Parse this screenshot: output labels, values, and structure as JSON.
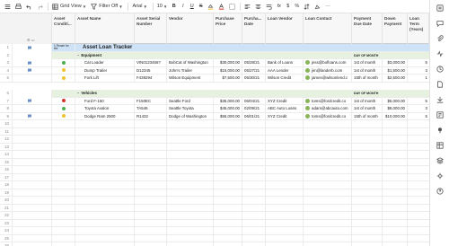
{
  "toolbar": {
    "view_label": "Grid View",
    "filter_label": "Filter Off",
    "font_label": "Arial",
    "font_size": "10"
  },
  "columns": [
    {
      "label": "Asset Conditi..."
    },
    {
      "label": "Asset Name"
    },
    {
      "label": "Asset Serial Number"
    },
    {
      "label": "Vendor"
    },
    {
      "label": "Purchase Price"
    },
    {
      "label": "Purcha... Date"
    },
    {
      "label": "Loan Vendor"
    },
    {
      "label": "Loan Contact"
    },
    {
      "label": "Payment Due Date"
    },
    {
      "label": "Down Payment"
    },
    {
      "label": "Loan Term (Years)"
    }
  ],
  "row1": {
    "num": "1",
    "note": "1 Reoair for tire",
    "title": "Asset Loan Tracker"
  },
  "row2": {
    "num": "2",
    "section": "Equipment",
    "due": "DAY OF MONTH"
  },
  "row6": {
    "num": "6",
    "section": "Vehicles",
    "due": "DAY OF MONTH"
  },
  "rows": [
    {
      "num": "3",
      "condition": "green",
      "name": "Cat Loader",
      "serial": "VIN0123456?",
      "vendor": "BobCat of Washington",
      "price": "$30,000.00",
      "date": "05/28/21",
      "loan_vendor": "Bank of Loans",
      "contact": "jess@bofloans.com",
      "due": "1st of month",
      "down": "$3,000.00",
      "term": "5"
    },
    {
      "num": "4",
      "condition": "yellow",
      "name": "Dump Trailer",
      "serial": "D12345",
      "vendor": "John's Trailer",
      "price": "$15,000.00",
      "date": "05/27/21",
      "loan_vendor": "AAA Lender",
      "contact": "jim@landerb.com",
      "due": "1st of month",
      "down": "$1,500.00",
      "term": "3"
    },
    {
      "num": "5",
      "condition": "yellow",
      "name": "Fork Lift",
      "serial": "F439294",
      "vendor": "Wilson Equipment",
      "price": "$7,500.00",
      "date": "05/30/21",
      "loan_vendor": "Wilson Credit",
      "contact": "james@wilsonlend.c",
      "due": "15th of month",
      "down": "$2,500.00",
      "term": "1"
    },
    {
      "num": "7",
      "condition": "red",
      "name": "Ford F-150",
      "serial": "F150EC",
      "vendor": "Seattle Ford",
      "price": "$35,000.00",
      "date": "06/04/21",
      "loan_vendor": "XYZ Credit",
      "contact": "toms@fordcredit.co",
      "due": "1st of month",
      "down": "$5,000.00",
      "term": "5"
    },
    {
      "num": "8",
      "condition": "green",
      "name": "Toyota Avalon",
      "serial": "TA546",
      "vendor": "Seattle Toyota",
      "price": "$45,000.00",
      "date": "02/09/21",
      "loan_vendor": "ABC Auto Loans",
      "contact": "adam@abcauto.com",
      "due": "1st of month",
      "down": "$8,000.00",
      "term": "3"
    },
    {
      "num": "9",
      "condition": "yellow",
      "name": "Dodge Ram 2500",
      "serial": "R1432",
      "vendor": "Dodge of Washington",
      "price": "$55,000.00",
      "date": "06/01/21",
      "loan_vendor": "XYZ Credit",
      "contact": "toms@fordcredit.co",
      "due": "15th of month",
      "down": "$10,000.00",
      "term": "5"
    }
  ],
  "empty_rows": [
    "10",
    "11",
    "12",
    "13",
    "14",
    "15",
    "16",
    "17",
    "18",
    "19",
    "20",
    "21",
    "22",
    "23",
    "24",
    "25",
    "26"
  ],
  "colors": {
    "green": "#4caf50",
    "yellow": "#f2c230",
    "red": "#d9342b",
    "title_band": "#cfe3f8",
    "section_band": "#e6f1e0"
  }
}
